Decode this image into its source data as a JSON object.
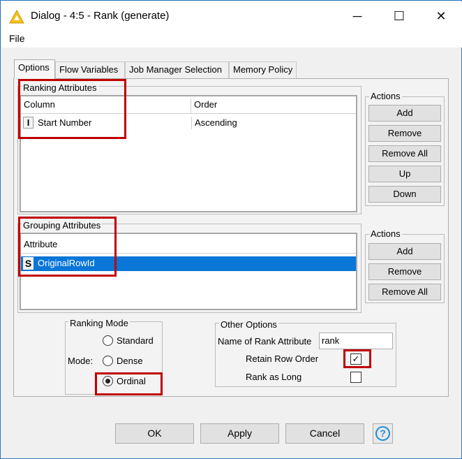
{
  "window": {
    "title": "Dialog - 4:5 - Rank (generate)",
    "controls": {
      "minimize": "─",
      "maximize": "☐",
      "close": "✕"
    },
    "accent": "#2b78c5"
  },
  "menu": {
    "file": "File"
  },
  "tabs": [
    {
      "label": "Options",
      "active": true
    },
    {
      "label": "Flow Variables",
      "active": false
    },
    {
      "label": "Job Manager Selection",
      "active": false
    },
    {
      "label": "Memory Policy",
      "active": false
    }
  ],
  "ranking": {
    "title": "Ranking Attributes",
    "headers": [
      "Column",
      "Order"
    ],
    "rows": [
      {
        "type_icon": "I",
        "column": "Start Number",
        "order": "Ascending"
      }
    ],
    "actions_title": "Actions",
    "actions": [
      "Add",
      "Remove",
      "Remove All",
      "Up",
      "Down"
    ]
  },
  "grouping": {
    "title": "Grouping Attributes",
    "header": "Attribute",
    "rows": [
      {
        "type_icon": "S",
        "attribute": "OriginalRowId",
        "selected": true
      }
    ],
    "actions_title": "Actions",
    "actions": [
      "Add",
      "Remove",
      "Remove All"
    ]
  },
  "ranking_mode": {
    "title": "Ranking Mode",
    "mode_label": "Mode:",
    "options": [
      {
        "label": "Standard",
        "selected": false
      },
      {
        "label": "Dense",
        "selected": false
      },
      {
        "label": "Ordinal",
        "selected": true
      }
    ]
  },
  "other_options": {
    "title": "Other Options",
    "name_label": "Name of Rank Attribute",
    "name_value": "rank",
    "retain_label": "Retain Row Order",
    "retain_checked": true,
    "retain_mark": "✓",
    "long_label": "Rank as Long",
    "long_checked": false
  },
  "buttons": {
    "ok": "OK",
    "apply": "Apply",
    "cancel": "Cancel",
    "help": "?"
  },
  "colors": {
    "selection": "#0a76d8",
    "highlight": "#c00000",
    "help_blue": "#1c8ad8"
  }
}
